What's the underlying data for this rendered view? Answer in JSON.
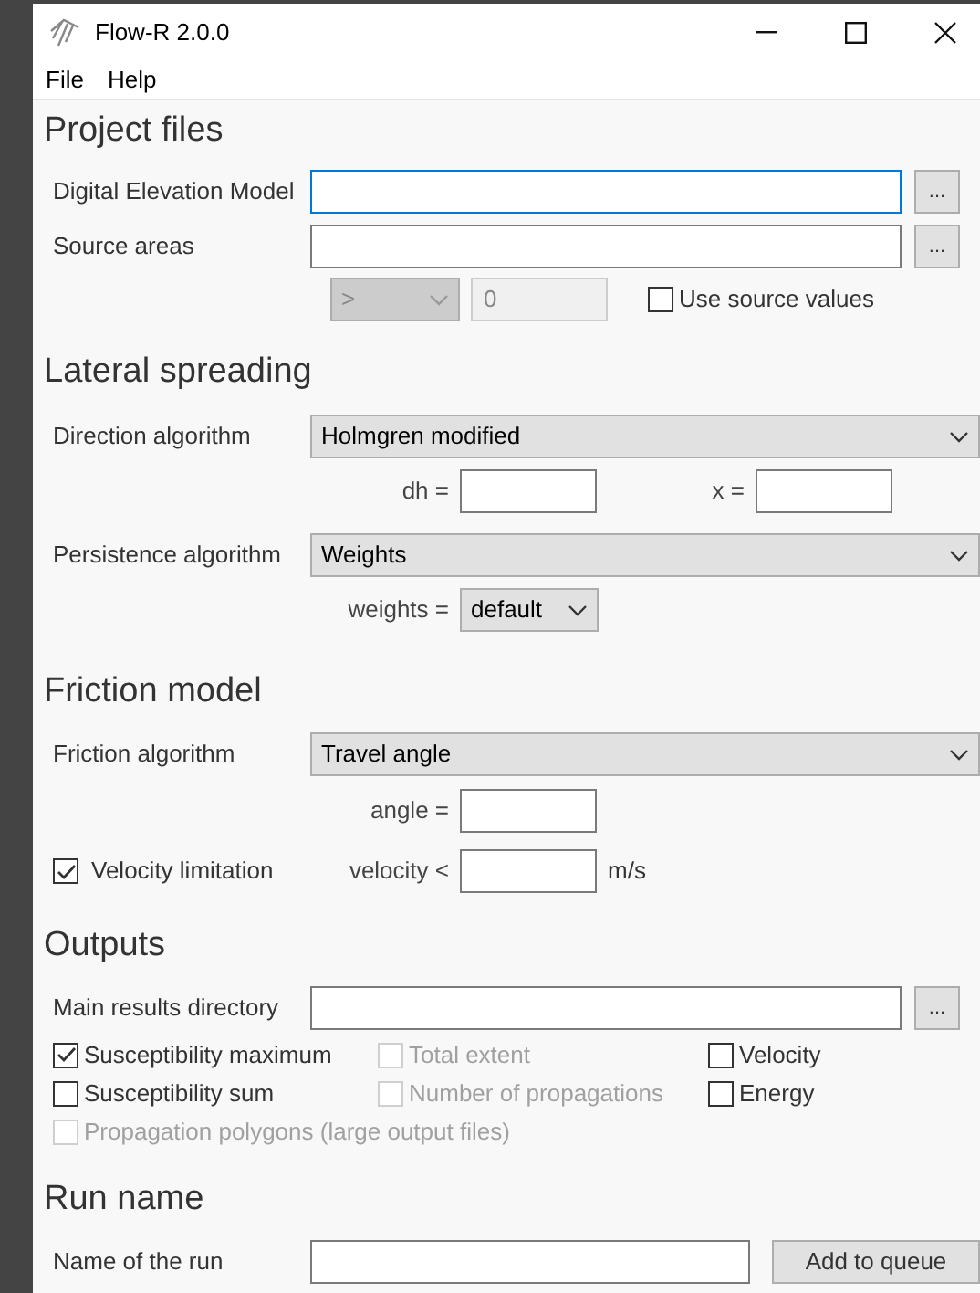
{
  "window": {
    "title": "Flow-R 2.0.0"
  },
  "menu": [
    {
      "label": "File"
    },
    {
      "label": "Help"
    }
  ],
  "project_files": {
    "heading": "Project files",
    "dem": {
      "label": "Digital Elevation Model",
      "focused": true,
      "browse": "..."
    },
    "source_areas": {
      "label": "Source areas",
      "focused": false,
      "browse": "..."
    },
    "threshold_operator": {
      "value": ">",
      "disabled": true
    },
    "threshold_value": {
      "value": "0",
      "disabled": true
    },
    "use_source_values": {
      "label": "Use source values",
      "checked": false,
      "disabled": false
    }
  },
  "lateral_spreading": {
    "heading": "Lateral spreading",
    "direction": {
      "label": "Direction algorithm",
      "value": "Holmgren modified"
    },
    "dh": {
      "label": "dh ="
    },
    "x": {
      "label": "x ="
    },
    "persistence": {
      "label": "Persistence algorithm",
      "value": "Weights"
    },
    "weights": {
      "label": "weights =",
      "value": "default"
    }
  },
  "friction_model": {
    "heading": "Friction model",
    "algorithm": {
      "label": "Friction algorithm",
      "value": "Travel angle"
    },
    "angle": {
      "label": "angle ="
    },
    "velocity_limitation": {
      "label": "Velocity limitation",
      "checked": true,
      "disabled": false
    },
    "velocity": {
      "label": "velocity <",
      "unit": "m/s"
    }
  },
  "outputs": {
    "heading": "Outputs",
    "directory": {
      "label": "Main results directory",
      "focused": false,
      "browse": "..."
    },
    "options": [
      {
        "label": "Susceptibility maximum",
        "checked": true,
        "disabled": false
      },
      {
        "label": "Total extent",
        "checked": false,
        "disabled": true
      },
      {
        "label": "Velocity",
        "checked": false,
        "disabled": false
      },
      {
        "label": "Susceptibility sum",
        "checked": false,
        "disabled": false
      },
      {
        "label": "Number of propagations",
        "checked": false,
        "disabled": true
      },
      {
        "label": "Energy",
        "checked": false,
        "disabled": false
      },
      {
        "label": "Propagation polygons (large output files)",
        "checked": false,
        "disabled": true
      }
    ]
  },
  "run_name": {
    "heading": "Run name",
    "name": {
      "label": "Name of the run"
    },
    "add_button": "Add to queue"
  }
}
